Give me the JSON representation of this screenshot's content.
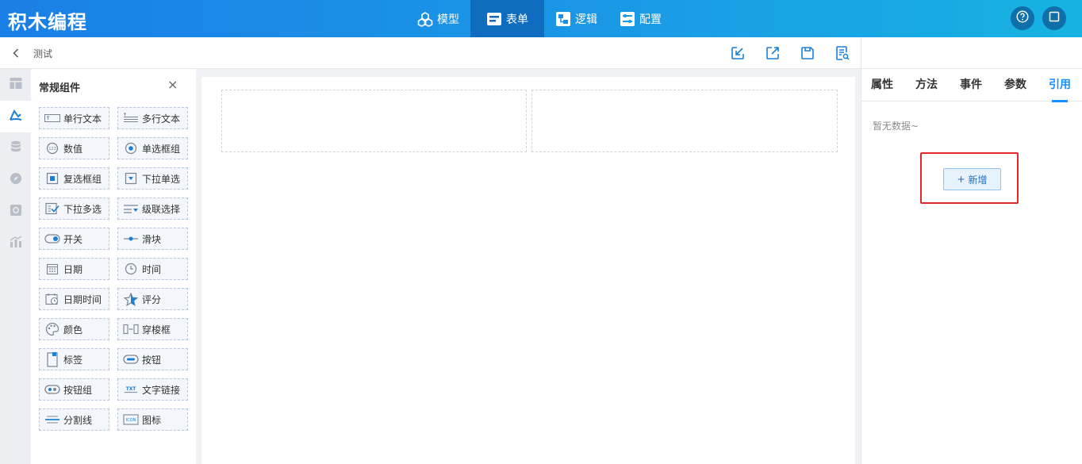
{
  "app": {
    "title": "积木编程"
  },
  "topnav": {
    "tabs": [
      {
        "label": "模型",
        "icon": "cubes-icon",
        "active": false
      },
      {
        "label": "表单",
        "icon": "form-icon",
        "active": true
      },
      {
        "label": "逻辑",
        "icon": "logic-icon",
        "active": false
      },
      {
        "label": "配置",
        "icon": "config-icon",
        "active": false
      }
    ],
    "right_icons": [
      "help-icon",
      "window-icon"
    ]
  },
  "subheader": {
    "page_name": "测试",
    "tools": [
      "import-icon",
      "export-icon",
      "save-icon",
      "preview-icon"
    ]
  },
  "rail": {
    "items": [
      "layout-icon",
      "component-icon",
      "database-icon",
      "compass-icon",
      "media-icon",
      "chart-icon"
    ],
    "active_index": 1
  },
  "component_panel": {
    "title": "常规组件",
    "close_glyph": "×",
    "items": [
      {
        "label": "单行文本",
        "icon": "single-text-icon"
      },
      {
        "label": "多行文本",
        "icon": "multi-text-icon"
      },
      {
        "label": "数值",
        "icon": "number-icon"
      },
      {
        "label": "单选框组",
        "icon": "radio-icon"
      },
      {
        "label": "复选框组",
        "icon": "checkbox-icon"
      },
      {
        "label": "下拉单选",
        "icon": "select-icon"
      },
      {
        "label": "下拉多选",
        "icon": "multi-select-icon"
      },
      {
        "label": "级联选择",
        "icon": "cascader-icon"
      },
      {
        "label": "开关",
        "icon": "switch-icon"
      },
      {
        "label": "滑块",
        "icon": "slider-icon"
      },
      {
        "label": "日期",
        "icon": "date-icon"
      },
      {
        "label": "时间",
        "icon": "time-icon"
      },
      {
        "label": "日期时间",
        "icon": "datetime-icon"
      },
      {
        "label": "评分",
        "icon": "rate-icon"
      },
      {
        "label": "颜色",
        "icon": "color-icon"
      },
      {
        "label": "穿梭框",
        "icon": "transfer-icon"
      },
      {
        "label": "标签",
        "icon": "tag-icon"
      },
      {
        "label": "按钮",
        "icon": "button-icon"
      },
      {
        "label": "按钮组",
        "icon": "button-group-icon"
      },
      {
        "label": "文字链接",
        "icon": "text-link-icon"
      },
      {
        "label": "分割线",
        "icon": "divider-icon"
      },
      {
        "label": "图标",
        "icon": "icon-component-icon"
      }
    ]
  },
  "canvas": {
    "cells": 2
  },
  "right_panel": {
    "tabs": [
      {
        "label": "属性",
        "active": false
      },
      {
        "label": "方法",
        "active": false
      },
      {
        "label": "事件",
        "active": false
      },
      {
        "label": "参数",
        "active": false
      },
      {
        "label": "引用",
        "active": true
      }
    ],
    "empty_text": "暂无数据~",
    "add_button": {
      "glyph": "+",
      "label": "新增"
    }
  },
  "colors": {
    "accent": "#1890ff",
    "header_gradient_start": "#1a7fe6",
    "header_gradient_end": "#17b2e2",
    "active_tab": "#0f6cbf",
    "highlight": "#e5272b"
  }
}
